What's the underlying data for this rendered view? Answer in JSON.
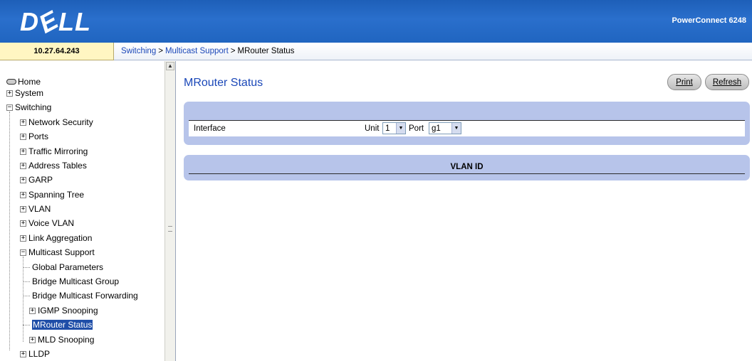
{
  "header": {
    "logo_text": "DELL",
    "product_name": "PowerConnect 6248"
  },
  "crumbbar": {
    "ip_address": "10.27.64.243",
    "breadcrumb": [
      "Switching",
      "Multicast Support",
      "MRouter Status"
    ],
    "separator": ">"
  },
  "nav": {
    "items": [
      {
        "label": "Home",
        "level": 0,
        "kind": "home"
      },
      {
        "label": "System",
        "level": 0,
        "kind": "collapsed"
      },
      {
        "label": "Switching",
        "level": 0,
        "kind": "expanded"
      },
      {
        "label": "Network Security",
        "level": 1,
        "kind": "collapsed"
      },
      {
        "label": "Ports",
        "level": 1,
        "kind": "collapsed"
      },
      {
        "label": "Traffic Mirroring",
        "level": 1,
        "kind": "collapsed"
      },
      {
        "label": "Address Tables",
        "level": 1,
        "kind": "collapsed"
      },
      {
        "label": "GARP",
        "level": 1,
        "kind": "collapsed"
      },
      {
        "label": "Spanning Tree",
        "level": 1,
        "kind": "collapsed"
      },
      {
        "label": "VLAN",
        "level": 1,
        "kind": "collapsed"
      },
      {
        "label": "Voice VLAN",
        "level": 1,
        "kind": "collapsed"
      },
      {
        "label": "Link Aggregation",
        "level": 1,
        "kind": "collapsed"
      },
      {
        "label": "Multicast Support",
        "level": 1,
        "kind": "expanded"
      },
      {
        "label": "Global Parameters",
        "level": 2,
        "kind": "leaf"
      },
      {
        "label": "Bridge Multicast Group",
        "level": 2,
        "kind": "leaf"
      },
      {
        "label": "Bridge Multicast Forwarding",
        "level": 2,
        "kind": "leaf"
      },
      {
        "label": "IGMP Snooping",
        "level": 2,
        "kind": "collapsed"
      },
      {
        "label": "MRouter Status",
        "level": 2,
        "kind": "leaf",
        "selected": true
      },
      {
        "label": "MLD Snooping",
        "level": 2,
        "kind": "collapsed"
      },
      {
        "label": "LLDP",
        "level": 1,
        "kind": "collapsed"
      }
    ]
  },
  "main": {
    "title": "MRouter Status",
    "print_label": "Print",
    "refresh_label": "Refresh",
    "interface_label": "Interface",
    "unit_label": "Unit",
    "unit_value": "1",
    "port_label": "Port",
    "port_value": "g1",
    "vlan_id_header": "VLAN ID"
  },
  "colors": {
    "header_blue": "#2065c0",
    "link_blue": "#1a47b8",
    "panel_lavender": "#b7c4ea",
    "ip_box_yellow": "#fff6c2",
    "selected_bg": "#1f4ea8"
  }
}
